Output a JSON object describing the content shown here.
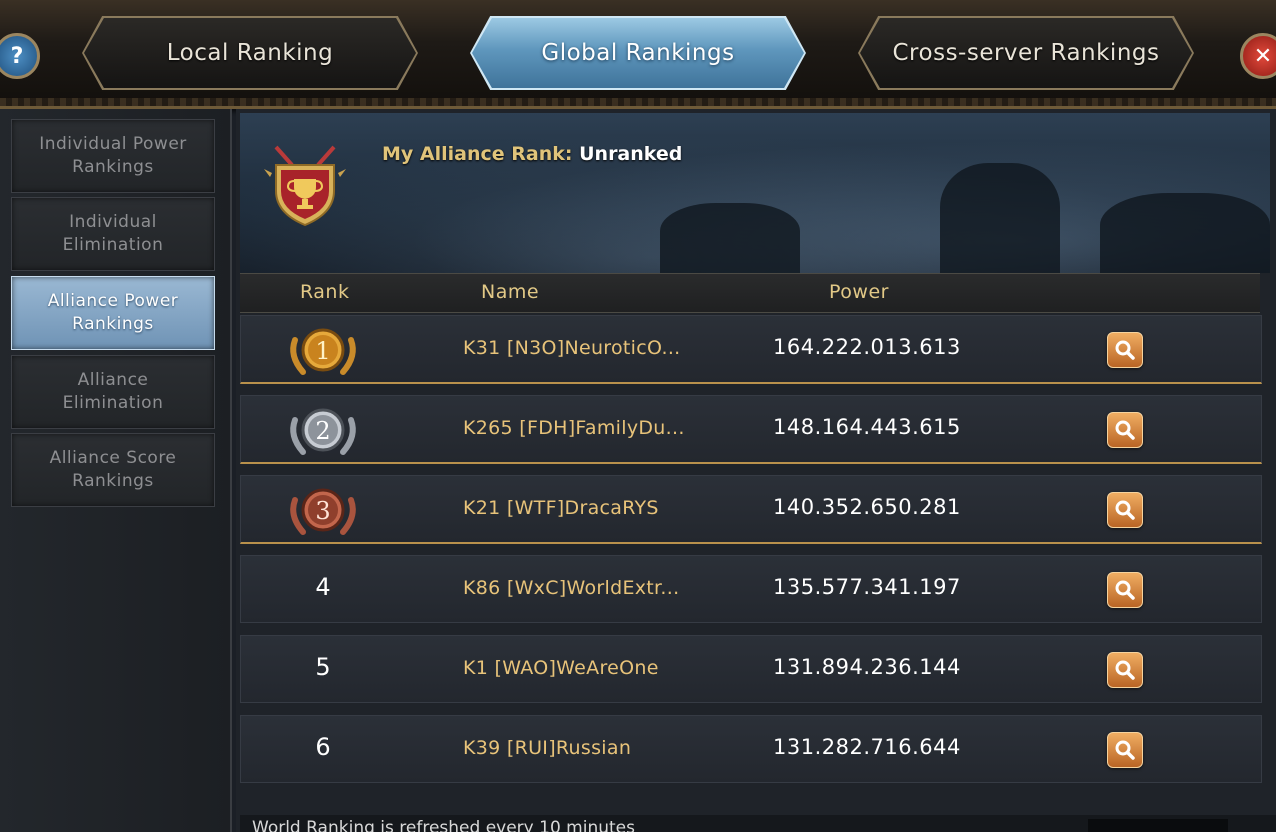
{
  "tabs": [
    {
      "label": "Local Ranking",
      "active": false
    },
    {
      "label": "Global Rankings",
      "active": true
    },
    {
      "label": "Cross-server Rankings",
      "active": false
    }
  ],
  "help_label": "?",
  "close_label": "✕",
  "sidebar": {
    "items": [
      {
        "label": "Individual Power\nRankings",
        "active": false
      },
      {
        "label": "Individual\nElimination",
        "active": false
      },
      {
        "label": "Alliance Power\nRankings",
        "active": true
      },
      {
        "label": "Alliance\nElimination",
        "active": false
      },
      {
        "label": "Alliance Score\nRankings",
        "active": false
      }
    ]
  },
  "banner": {
    "my_rank_label": "My Alliance Rank:",
    "my_rank_value": "Unranked"
  },
  "table": {
    "headers": {
      "rank": "Rank",
      "name": "Name",
      "power": "Power"
    },
    "rows": [
      {
        "rank": "1",
        "name": "K31 [N3O]NeuroticO...",
        "power": "164.222.013.613",
        "medal": "gold"
      },
      {
        "rank": "2",
        "name": "K265 [FDH]FamilyDu...",
        "power": "148.164.443.615",
        "medal": "silver"
      },
      {
        "rank": "3",
        "name": "K21 [WTF]DracaRYS",
        "power": "140.352.650.281",
        "medal": "bronze"
      },
      {
        "rank": "4",
        "name": "K86 [WxC]WorldExtr...",
        "power": "135.577.341.197",
        "medal": ""
      },
      {
        "rank": "5",
        "name": "K1 [WAO]WeAreOne",
        "power": "131.894.236.144",
        "medal": ""
      },
      {
        "rank": "6",
        "name": "K39 [RUI]Russian",
        "power": "131.282.716.644",
        "medal": ""
      }
    ]
  },
  "footer": {
    "note": "World Ranking is refreshed every 10 minutes"
  },
  "colors": {
    "accent_gold": "#e2c987",
    "active_tab": "#5f97bd",
    "name_text": "#e8c37a",
    "search_button": "#d88a3e"
  },
  "icons": {
    "help": "question-icon",
    "close": "close-icon",
    "trophy": "trophy-shield-icon",
    "search": "magnifier-icon",
    "medal": "laurel-medal-icon"
  }
}
